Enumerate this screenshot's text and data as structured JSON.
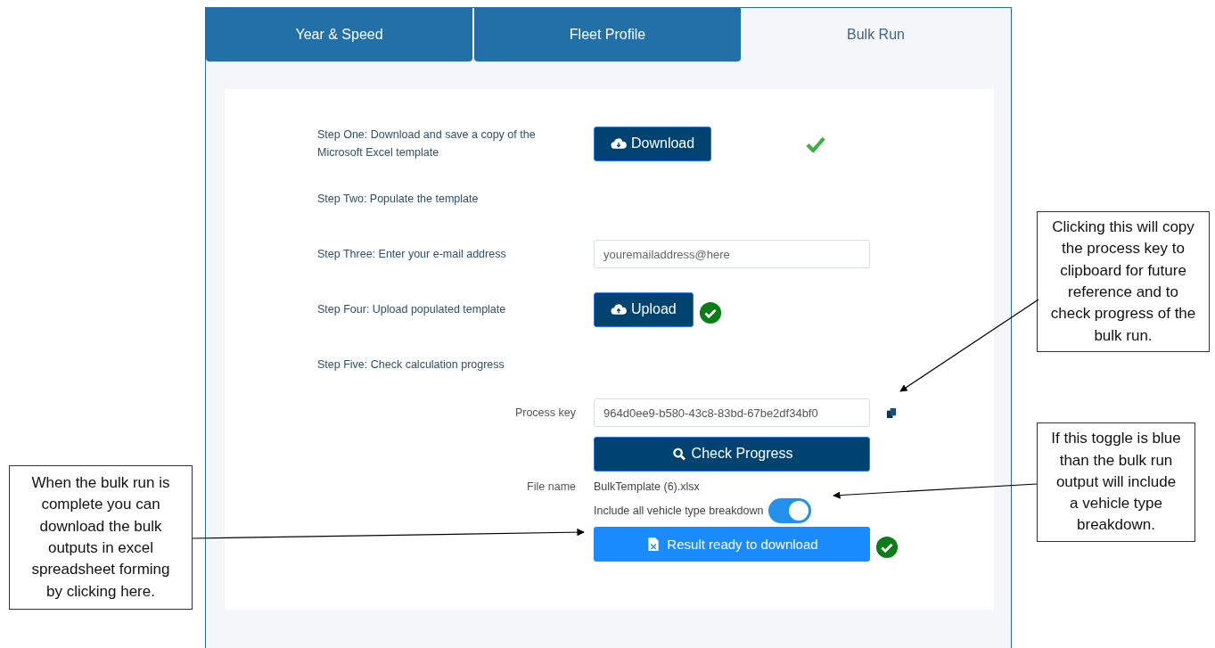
{
  "tabs": [
    {
      "label": "Year & Speed",
      "selected": false
    },
    {
      "label": "Fleet Profile",
      "selected": false
    },
    {
      "label": "Bulk Run",
      "selected": true
    }
  ],
  "steps": [
    {
      "kind": "button",
      "label": "Step One: Download and save a copy of the Microsoft Excel template",
      "button": "Download",
      "done": true
    },
    {
      "kind": "text",
      "label": "Step Two: Populate the template"
    },
    {
      "kind": "field",
      "label": "Step Three: Enter your e-mail address",
      "placeholder": "youremailaddress@here"
    },
    {
      "kind": "button",
      "label": "Step Four: Upload populated template",
      "button": "Upload",
      "done": true
    },
    {
      "kind": "text",
      "label": "Step Five: Check calculation progress"
    }
  ],
  "process": {
    "label": "Process key",
    "value": "964d0ee9-b580-43c8-83bd-67be2df34bf0",
    "check_button": "Check Progress",
    "file_label": "File name",
    "file_name": "BulkTemplate (6).xlsx",
    "toggle": {
      "label": "Include all vehicle type breakdown",
      "on": true
    },
    "result_button": "Result ready to download",
    "result_done": true
  },
  "annotations": [
    {
      "text": "Clicking this will copy the process key to clipboard for future reference and to check progress of the bulk run."
    },
    {
      "text": "If this toggle is blue than the bulk run output will include a vehicle type breakdown."
    },
    {
      "text": "When the bulk run is complete you can download the bulk outputs in excel spreadsheet forming by clicking here."
    }
  ]
}
